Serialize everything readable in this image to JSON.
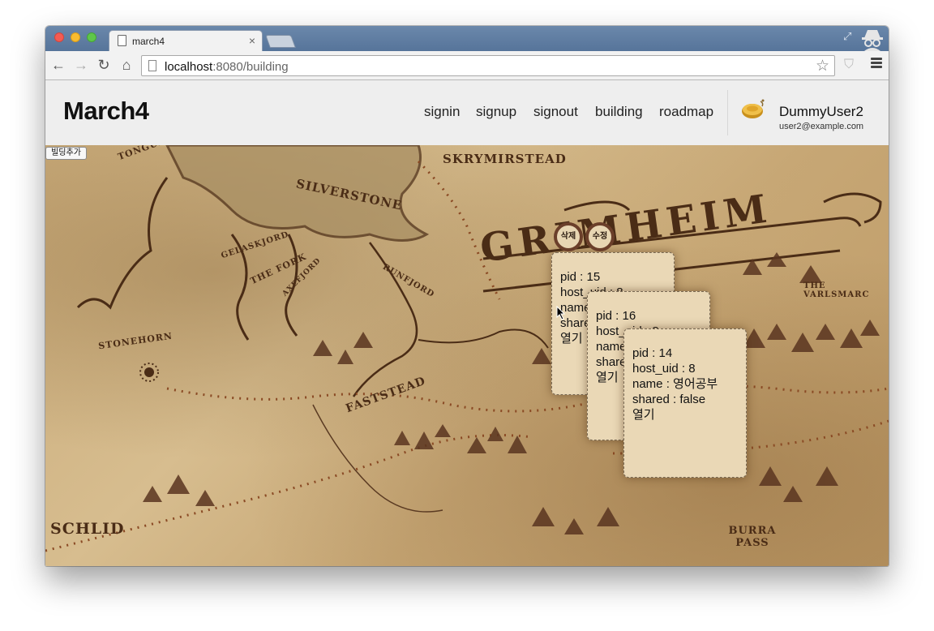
{
  "browser": {
    "tab_title": "march4",
    "url_host": "localhost",
    "url_rest": ":8080/building"
  },
  "site": {
    "brand": "March4",
    "nav": [
      "signin",
      "signup",
      "signout",
      "building",
      "roadmap"
    ],
    "user": {
      "name": "DummyUser2",
      "email": "user2@example.com"
    }
  },
  "map": {
    "add_button": "빌딩추가",
    "labels": [
      "SKRYMIRSTEAD",
      "SILVERSTONE",
      "GELASKJORD",
      "THE FORK",
      "AXEFJORD",
      "RUNFJORD",
      "STONEHORN",
      "FASTSTEAD",
      "SCHLID",
      "BURRA PASS",
      "THE VARLSMARC",
      "TONGUE",
      "GRIMHEIM"
    ],
    "delete_button": "삭제",
    "edit_button": "수정",
    "cards": [
      {
        "pid": "pid : 15",
        "host": "host_uid : 8",
        "name": "name : ",
        "shared": "shared : ",
        "open": "열기"
      },
      {
        "pid": "pid : 16",
        "host": "host_uid : 8",
        "name": "name : ",
        "shared": "shared : ",
        "open": "열기"
      },
      {
        "pid": "pid : 14",
        "host": "host_uid : 8",
        "name": "name : 영어공부",
        "shared": "shared : false",
        "open": "열기"
      }
    ]
  },
  "colors": {
    "ink": "#4a2c16",
    "card_bg": "#ead8b6",
    "button_ring": "#6b3f2a"
  }
}
